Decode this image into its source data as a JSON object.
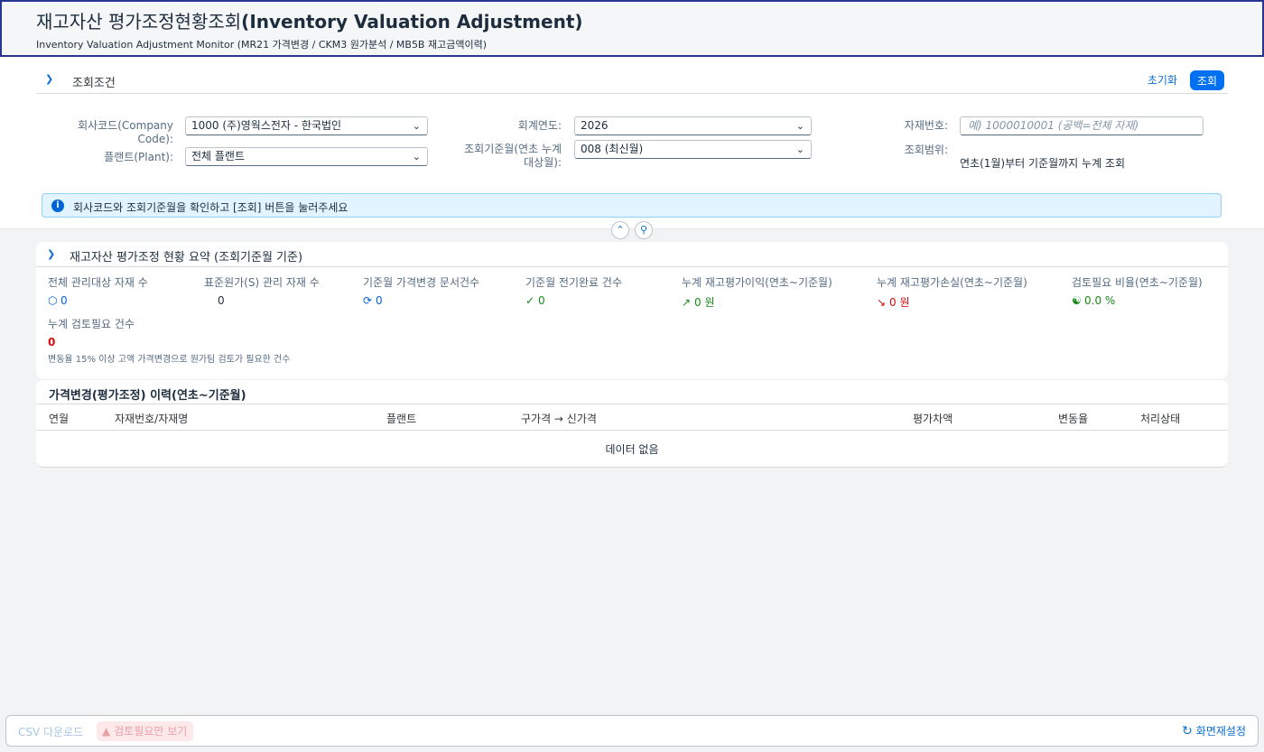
{
  "header": {
    "title_ko": "재고자산 평가조정현황조회",
    "title_en": "(Inventory Valuation Adjustment)",
    "subtitle": "Inventory Valuation Adjustment Monitor (MR21 가격변경 / CKM3 원가분석 / MB5B 재고금액이력)"
  },
  "filter": {
    "title": "조회조건",
    "reset_label": "초기화",
    "search_label": "조회",
    "company_code": {
      "label": "회사코드(Company Code):",
      "value": "1000 (주)영웍스전자 - 한국법인"
    },
    "plant": {
      "label": "플랜트(Plant):",
      "value": "전체 플랜트"
    },
    "fiscal_year": {
      "label": "회계연도:",
      "value": "2026"
    },
    "period": {
      "label_line1": "조회기준월(연초 누계",
      "label_line2": "대상월):",
      "value": "008 (최신월)"
    },
    "material": {
      "label": "자재번호:",
      "placeholder": "예) 1000010001 (공백=전체 자재)"
    },
    "range": {
      "label": "조회범위:",
      "value": "연초(1월)부터 기준월까지 누계 조회"
    },
    "message": "회사코드와 조회기준월을 확인하고 [조회] 버튼을 눌러주세요"
  },
  "summary": {
    "title": "재고자산 평가조정 현황 요약 (조회기준월 기준)",
    "kpis": [
      {
        "label": "전체 관리대상 자재 수",
        "value": "0",
        "icon": "cube-icon"
      },
      {
        "label": "표준원가(S) 관리 자재 수",
        "value": "0"
      },
      {
        "label": "기준월 가격변경 문서건수",
        "value": "0",
        "icon": "refresh-icon"
      },
      {
        "label": "기준월 전기완료 건수",
        "value": "0",
        "icon": "checkmark-icon"
      },
      {
        "label": "누계 재고평가이익(연초~기준월)",
        "value": "0 원",
        "icon": "trend-up-icon"
      },
      {
        "label": "누계 재고평가손실(연초~기준월)",
        "value": "0 원",
        "icon": "trend-down-icon"
      },
      {
        "label": "검토필요 비율(연초~기준월)",
        "value": "0.0 %",
        "icon": "review-icon"
      },
      {
        "label": "누계 검토필요 건수",
        "value": "0",
        "note": "변동율 15% 이상 고액 가격변경으로 원가팀 검토가 필요한 건수"
      }
    ]
  },
  "history": {
    "title": "가격변경(평가조정) 이력(연초~기준월)",
    "columns": [
      "연월",
      "자재번호/자재명",
      "플랜트",
      "구가격 → 신가격",
      "평가차액",
      "변동율",
      "처리상태"
    ],
    "empty_text": "데이터 없음"
  },
  "footer": {
    "csv_label": "CSV 다운로드",
    "review_only_label": "검토필요만 보기",
    "reset_screen_label": "화면재설정"
  },
  "colors": {
    "accent": "#0070f2",
    "positive": "#188918",
    "negative": "#d20a0a",
    "header_border": "#283593"
  }
}
